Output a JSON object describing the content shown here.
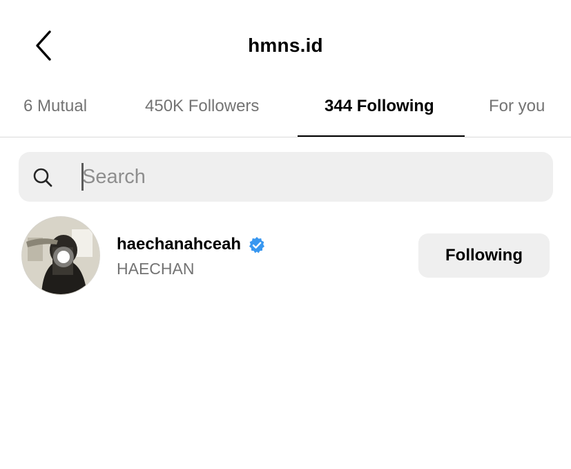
{
  "header": {
    "title": "hmns.id",
    "back_icon": "chevron-left-icon"
  },
  "tabs": [
    {
      "label": "6 Mutual",
      "active": false
    },
    {
      "label": "450K Followers",
      "active": false
    },
    {
      "label": "344 Following",
      "active": true
    },
    {
      "label": "For you",
      "active": false
    }
  ],
  "search": {
    "placeholder": "Search",
    "value": "",
    "icon": "search-icon"
  },
  "accounts": [
    {
      "username": "haechanahceah",
      "full_name": "HAECHAN",
      "verified": true,
      "verified_color": "#3897f0",
      "button_label": "Following"
    }
  ]
}
